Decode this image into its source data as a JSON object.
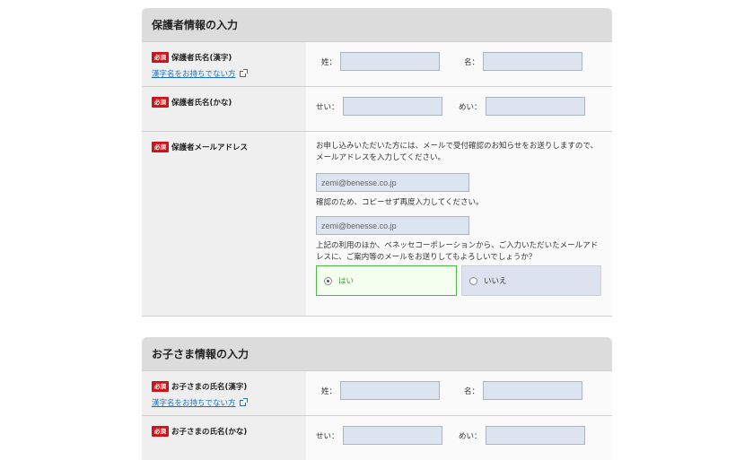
{
  "guardian": {
    "title": "保護者情報の入力",
    "required_badge": "必須",
    "kanji_name": {
      "label": "保護者氏名(漢字)",
      "help_link": "漢字名をお持ちでない方",
      "last_label": "姓：",
      "first_label": "名："
    },
    "kana_name": {
      "label": "保護者氏名(かな)",
      "last_label": "せい：",
      "first_label": "めい："
    },
    "email": {
      "label": "保護者メールアドレス",
      "note1": "お申し込みいただいた方には、メールで受付確認のお知らせをお送りしますので、メールアドレスを入力してください。",
      "email_value": "zemi@benesse.co.jp",
      "confirm_note": "確認のため、コピーせず再度入力してください。",
      "confirm_value": "zemi@benesse.co.jp",
      "consent_note": "上記の利用のほか、ベネッセコーポレーションから、ご入力いただいたメールアドレスに、ご案内等のメールをお送りしてもよろしいでしょうか？",
      "yes_label": "はい",
      "no_label": "いいえ"
    }
  },
  "child": {
    "title": "お子さま情報の入力",
    "required_badge": "必須",
    "kanji_name": {
      "label": "お子さまの氏名(漢字)",
      "help_link": "漢字名をお持ちでない方",
      "last_label": "姓：",
      "first_label": "名："
    },
    "kana_name": {
      "label": "お子さまの氏名(かな)",
      "last_label": "せい：",
      "first_label": "めい："
    }
  },
  "colors": {
    "required": "#d0121b",
    "link": "#1a73c8",
    "input_bg": "#dce4f0",
    "selected_border": "#4cb944"
  }
}
